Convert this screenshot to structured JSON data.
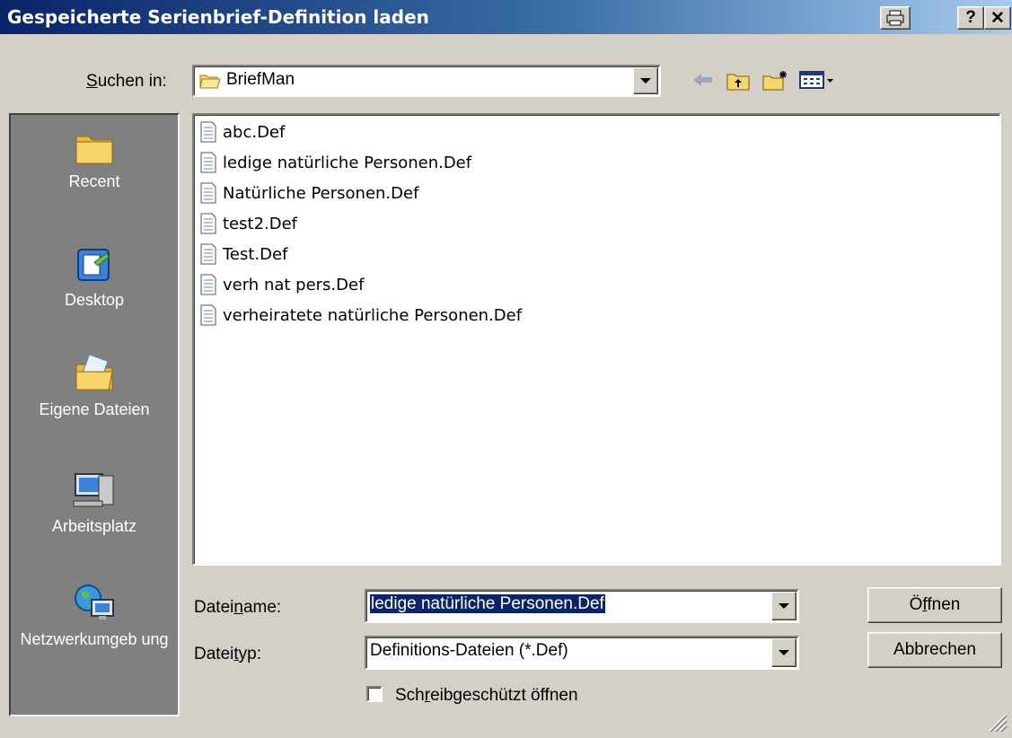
{
  "window": {
    "title": "Gespeicherte Serienbrief-Definition laden",
    "help_label": "?",
    "close_label": "✕"
  },
  "lookin": {
    "label_prefix": "S",
    "label_rest": "uchen in:",
    "value": "BriefMan"
  },
  "places": [
    {
      "label": "Recent",
      "icon": "recent-folder-icon"
    },
    {
      "label": "Desktop",
      "icon": "desktop-icon"
    },
    {
      "label": "Eigene Dateien",
      "icon": "my-documents-icon"
    },
    {
      "label": "Arbeitsplatz",
      "icon": "my-computer-icon"
    },
    {
      "label": "Netzwerkumgeb ung",
      "icon": "network-icon"
    }
  ],
  "files": [
    "abc.Def",
    "ledige natürliche Personen.Def",
    "Natürliche Personen.Def",
    "test2.Def",
    "Test.Def",
    "verh nat pers.Def",
    "verheiratete natürliche Personen.Def"
  ],
  "filename": {
    "label_a": "Datei",
    "label_u": "n",
    "label_b": "ame:",
    "value": "ledige natürliche Personen.Def"
  },
  "filetype": {
    "label_a": "Datei",
    "label_u": "t",
    "label_b": "yp:",
    "value": "Definitions-Dateien (*.Def)"
  },
  "readonly": {
    "label_a": "Sch",
    "label_u": "r",
    "label_b": "eibgeschützt öffnen",
    "checked": false
  },
  "buttons": {
    "open_a": "Ö",
    "open_u": "f",
    "open_b": "fnen",
    "cancel": "Abbrechen"
  }
}
